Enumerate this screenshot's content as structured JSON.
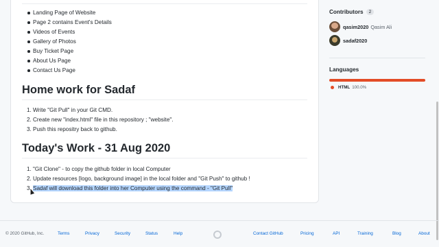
{
  "readme": {
    "bullets": [
      "Landing Page of Website",
      "Page 2 contains Event's Details",
      "Videos of Events",
      "Gallery of Photos",
      "Buy Ticket Page",
      "About Us Page",
      "Contact Us Page"
    ],
    "homework": {
      "heading": "Home work for Sadaf",
      "steps": [
        "Write \"Git Pull\" in your Git CMD.",
        "Create new \"index.html\" file in this repository ; \"website\".",
        "Push this repositry back to github."
      ]
    },
    "today": {
      "heading": "Today's Work - 31 Aug 2020",
      "steps": [
        "\"Git Clone\" - to copy the github folder in local Computer",
        "Update resources [logo, background image] in the local folder and \"Git Push\" to github !",
        "Sadaf will download this folder into her Computer using the command - \"Git Pull\""
      ]
    }
  },
  "sidebar": {
    "contributors": {
      "title": "Contributors",
      "count": "2",
      "people": [
        {
          "login": "qasim2020",
          "fullname": "Qasim Ali",
          "avatar": "avatar-qasim"
        },
        {
          "login": "sadaf2020",
          "fullname": "",
          "avatar": "avatar-sadaf"
        }
      ]
    },
    "languages": {
      "title": "Languages",
      "items": [
        {
          "name": "HTML",
          "percent": "100.0%",
          "color": "#e34c26"
        }
      ]
    }
  },
  "footer": {
    "copyright": "© 2020 GitHub, Inc.",
    "left_links": [
      "Terms",
      "Privacy",
      "Security",
      "Status",
      "Help"
    ],
    "right_links": [
      "Contact GitHub",
      "Pricing",
      "API",
      "Training",
      "Blog",
      "About"
    ],
    "logo_icon": "github-mark-icon"
  }
}
